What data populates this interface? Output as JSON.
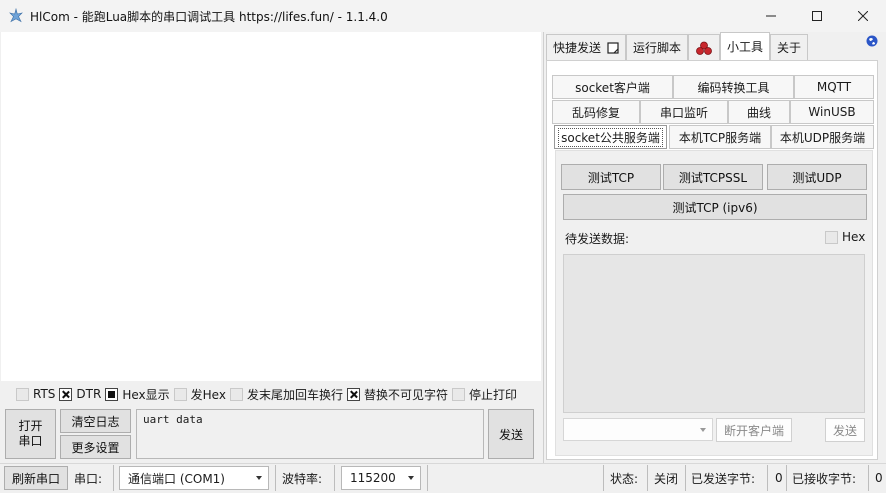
{
  "window": {
    "title": "HlCom - 能跑Lua脚本的串口调试工具 https://lifes.fun/ - 1.1.4.0",
    "minimize": "—",
    "maximize": "☐",
    "close": "✕"
  },
  "options": {
    "rts": {
      "label": "RTS",
      "checked": false
    },
    "dtr": {
      "label": "DTR",
      "checked": true
    },
    "hex_display": {
      "label": "Hex显示",
      "checked": true
    },
    "send_hex": {
      "label": "发Hex",
      "checked": false
    },
    "append_crlf": {
      "label": "发末尾加回车换行",
      "checked": false
    },
    "replace_invisible": {
      "label": "替换不可见字符",
      "checked": true
    },
    "stop_print": {
      "label": "停止打印",
      "checked": false
    }
  },
  "buttons": {
    "open_port": "打开\n串口",
    "clear_log": "清空日志",
    "more_settings": "更多设置",
    "send": "发送"
  },
  "send_input": {
    "value": "uart data"
  },
  "tabs": [
    {
      "label": "快捷发送",
      "icon": "note-icon"
    },
    {
      "label": "运行脚本"
    },
    {
      "label": "",
      "icon": "lua-icon"
    },
    {
      "label": "小工具",
      "active": true
    },
    {
      "label": "关于"
    }
  ],
  "subtabs": {
    "row1": [
      "socket客户端",
      "编码转换工具",
      "MQTT"
    ],
    "row2": [
      "乱码修复",
      "串口监听",
      "曲线",
      "WinUSB"
    ],
    "row3": [
      "socket公共服务端",
      "本机TCP服务端",
      "本机UDP服务端"
    ]
  },
  "socket_server": {
    "test_tcp": "测试TCP",
    "test_tcpssl": "测试TCPSSL",
    "test_udp": "测试UDP",
    "test_tcp_ipv6": "测试TCP (ipv6)",
    "pending_label": "待发送数据:",
    "hex_label": "Hex",
    "disconnect": "断开客户端",
    "send": "发送"
  },
  "statusbar": {
    "refresh": "刷新串口",
    "port_label": "串口:",
    "port_value": "通信端口 (COM1)",
    "baud_label": "波特率:",
    "baud_value": "115200",
    "state_label": "状态:",
    "state_value": "关闭",
    "sent_label": "已发送字节:",
    "sent_value": "0",
    "recv_label": "已接收字节:",
    "recv_value": "0"
  },
  "colors": {
    "globe": "#2b56c7",
    "lua_red": "#c8262c"
  }
}
